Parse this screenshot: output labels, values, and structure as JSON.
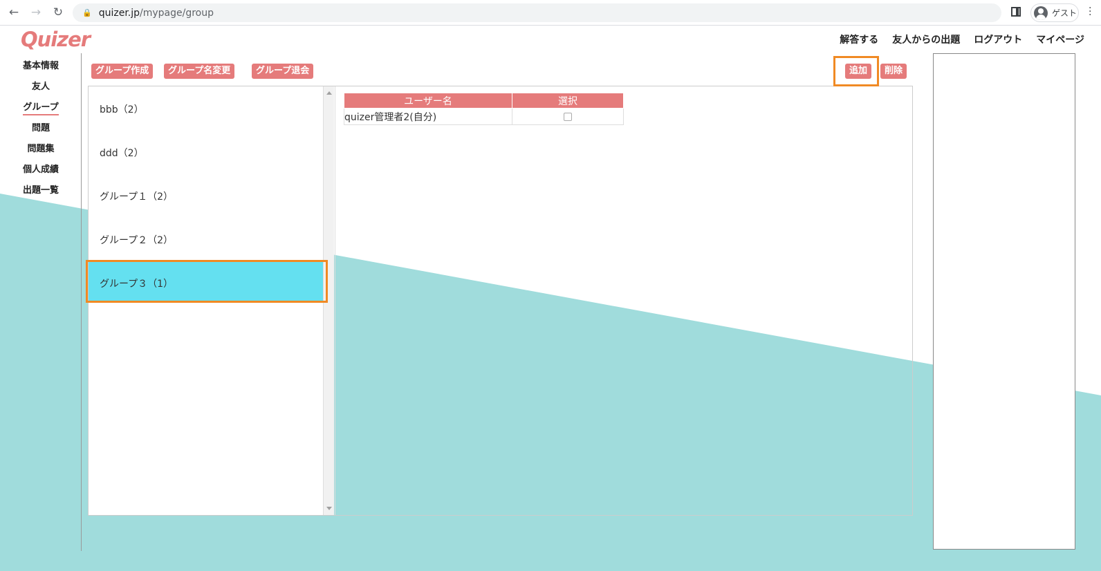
{
  "browser": {
    "back_icon": "back-arrow-icon",
    "forward_icon": "forward-arrow-icon",
    "reload_icon": "reload-icon",
    "url_host": "quizer.jp",
    "url_path": "/mypage/group",
    "profile_label": "ゲスト"
  },
  "header": {
    "logo": "Quizer",
    "nav": [
      "解答する",
      "友人からの出題",
      "ログアウト",
      "マイページ"
    ]
  },
  "sidebar": {
    "items": [
      "基本情報",
      "友人",
      "グループ",
      "問題",
      "問題集",
      "個人成績",
      "出題一覧"
    ],
    "active_index": 2
  },
  "toolbar": {
    "create_group": "グループ作成",
    "rename_group": "グループ名変更",
    "leave_group": "グループ退会",
    "add": "追加",
    "delete": "削除"
  },
  "groups": [
    {
      "name": "bbb（2）"
    },
    {
      "name": "ddd（2）"
    },
    {
      "name": "グループ１（2）"
    },
    {
      "name": "グループ２（2）"
    },
    {
      "name": "グループ３（1）",
      "selected": true
    }
  ],
  "member_table": {
    "headers": [
      "ユーザー名",
      "選択"
    ],
    "rows": [
      {
        "user": "quizer管理者2(自分)",
        "checked": false
      }
    ]
  },
  "colors": {
    "accent": "#e57b7b",
    "selected_row": "#64e0f0",
    "highlight": "#f08a24",
    "background_teal": "#a0dcdc"
  }
}
